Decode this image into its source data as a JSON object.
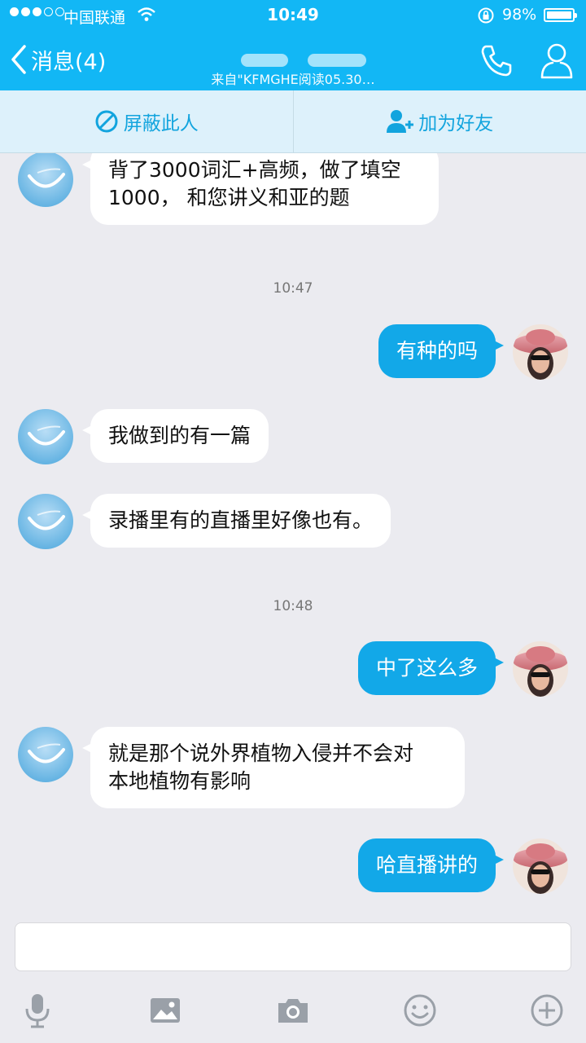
{
  "status_bar": {
    "carrier": "中国联通",
    "time": "10:49",
    "battery": "98%"
  },
  "header": {
    "back_label": "消息(4)",
    "subtitle": "来自\"KFMGHE阅读05.30…"
  },
  "actions": {
    "block": "屏蔽此人",
    "add_friend": "加为好友"
  },
  "messages": [
    {
      "type": "in",
      "text": "背了3000词汇+高频，做了填空\n1000， 和您讲义和亚的题"
    },
    {
      "type": "time",
      "text": "10:47"
    },
    {
      "type": "out",
      "text": "有种的吗"
    },
    {
      "type": "in",
      "text": "我做到的有一篇"
    },
    {
      "type": "in",
      "text": "录播里有的直播里好像也有。"
    },
    {
      "type": "time",
      "text": "10:48"
    },
    {
      "type": "out",
      "text": "中了这么多"
    },
    {
      "type": "in",
      "text": "就是那个说外界植物入侵并不会对\n本地植物有影响"
    },
    {
      "type": "out",
      "text": "哈直播讲的"
    }
  ],
  "colors": {
    "header_blue": "#12b7f5",
    "bubble_out": "#12a8e8",
    "bubble_in": "#ffffff",
    "background": "#ebebf0"
  },
  "toolbar_icons": [
    "microphone-icon",
    "image-icon",
    "camera-icon",
    "emoji-icon",
    "plus-icon"
  ]
}
